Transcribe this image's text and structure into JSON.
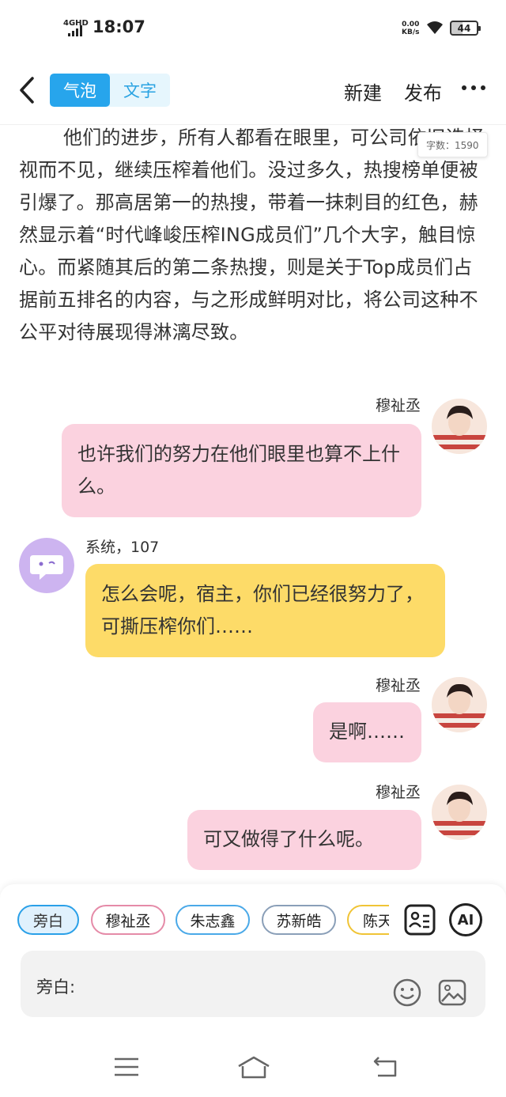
{
  "status_bar": {
    "network": "4GHD",
    "time": "18:07",
    "speed_value": "0.00",
    "speed_unit": "KB/s",
    "battery": "44"
  },
  "header": {
    "mode_options": [
      "气泡",
      "文字"
    ],
    "active_mode": "气泡",
    "new_label": "新建",
    "publish_label": "发布"
  },
  "narration": {
    "text": "他们的进步，所有人都看在眼里，可公司依旧选择视而不见，继续压榨着他们。没过多久，热搜榜单便被引爆了。那高居第一的热搜，带着一抹刺目的红色，赫然显示着“时代峰峻压榨ING成员们”几个大字，触目惊心。而紧随其后的第二条热搜，则是关于Top成员们占据前五排名的内容，与之形成鲜明对比，将公司这种不公平对待展现得淋漓尽致。",
    "word_count": "字数：1590"
  },
  "messages": [
    {
      "sender": "穆祉丞",
      "text": "也许我们的努力在他们眼里也算不上什么。"
    },
    {
      "sender": "系统，107",
      "text": "怎么会呢，宿主，你们已经很努力了，可撕压榨你们……"
    },
    {
      "sender": "穆祉丞",
      "text": "是啊……"
    },
    {
      "sender": "穆祉丞",
      "text": "可又做得了什么呢。"
    }
  ],
  "composer": {
    "roles": [
      "旁白",
      "穆祉丞",
      "朱志鑫",
      "苏新皓",
      "陈天"
    ],
    "active_role": "旁白",
    "ai_label": "AI",
    "input_label": "旁白:",
    "input_value": ""
  },
  "colors": {
    "accent": "#27a5ec",
    "bubble_pink": "#fbd2df",
    "bubble_yellow": "#fddb68",
    "system_avatar": "#cdb4f0"
  }
}
